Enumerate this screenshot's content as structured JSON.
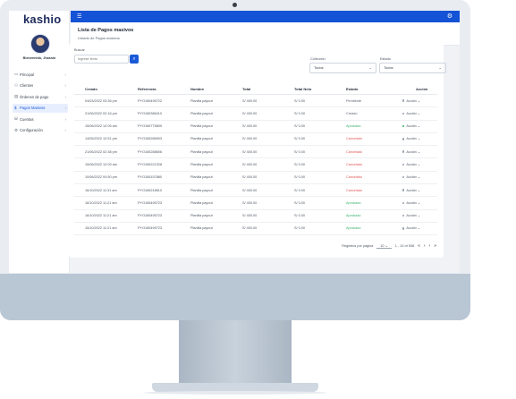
{
  "app": {
    "logo": "kashio",
    "welcome": "Bienvenido, Jhassin"
  },
  "sidebar": {
    "items": [
      {
        "icon": "monitor-icon",
        "glyph": "▭",
        "label": "Principal",
        "active": false
      },
      {
        "icon": "users-icon",
        "glyph": "⚇",
        "label": "Clientes",
        "active": false
      },
      {
        "icon": "clipboard-icon",
        "glyph": "▤",
        "label": "Órdenes de pago",
        "active": false
      },
      {
        "icon": "dollar-icon",
        "glyph": "$",
        "label": "Pagos Masivos",
        "active": true
      },
      {
        "icon": "cart-icon",
        "glyph": "⛁",
        "label": "Cuentas",
        "active": false
      },
      {
        "icon": "gear-icon",
        "glyph": "⚙",
        "label": "Configuración",
        "active": false
      }
    ]
  },
  "header": {
    "title": "Lista de Pagos masivos",
    "subtitle": "Listado de Pagos masivos"
  },
  "filters": {
    "search_label": "Buscar",
    "search_placeholder": "Ingrese texto",
    "coleccion_label": "Colección",
    "coleccion_value": "Todos",
    "estado_label": "Estado",
    "estado_value": "Todos"
  },
  "table": {
    "headers": [
      "Creado",
      "Referencia",
      "Nombre",
      "Total",
      "Total Neto",
      "Estado",
      "Acción"
    ],
    "rows": [
      {
        "creado": "04/03/2022 03:36 pm",
        "ref": "PYO165495722",
        "nombre": "Planilla payout",
        "total": "S/ 400.00",
        "neto": "S/ 0.00",
        "estado": "Pendiente",
        "estado_class": "pendiente",
        "accion": "Acción",
        "dot": "#9aa2ad"
      },
      {
        "creado": "21/06/2022 02:16 pm",
        "ref": "PYO165386410",
        "nombre": "Planilla payout",
        "total": "S/ 400.00",
        "neto": "S/ 0.00",
        "estado": "Creado",
        "estado_class": "creado",
        "accion": "Acción",
        "dot": "#9aa2ad"
      },
      {
        "creado": "15/06/2022 12:05 am",
        "ref": "PYO165775809",
        "nombre": "Planilla payout",
        "total": "S/ 400.00",
        "neto": "S/ 0.00",
        "estado": "Aprobado",
        "estado_class": "aprobado",
        "accion": "Acción",
        "dot": "#38b26a"
      },
      {
        "creado": "14/05/2022 12:51 pm",
        "ref": "PYO165286903",
        "nombre": "Planilla payout",
        "total": "S/ 400.00",
        "neto": "S/ 0.00",
        "estado": "Cancelado",
        "estado_class": "cancelado",
        "accion": "Acción",
        "dot": "#9aa2ad"
      },
      {
        "creado": "21/06/2022 02:38 pm",
        "ref": "PYO165288606",
        "nombre": "Planilla payout",
        "total": "S/ 400.00",
        "neto": "S/ 0.00",
        "estado": "Cancelado",
        "estado_class": "cancelado",
        "accion": "Acción",
        "dot": "#9aa2ad"
      },
      {
        "creado": "15/06/2022 12:09 am",
        "ref": "PYO165221328",
        "nombre": "Planilla payout",
        "total": "S/ 400.00",
        "neto": "S/ 0.00",
        "estado": "Cancelado",
        "estado_class": "cancelado",
        "accion": "Acción",
        "dot": "#9aa2ad"
      },
      {
        "creado": "10/06/2022 04:50 pm",
        "ref": "PYO165157880",
        "nombre": "Planilla payout",
        "total": "S/ 400.00",
        "neto": "S/ 0.00",
        "estado": "Cancelado",
        "estado_class": "cancelado",
        "accion": "Acción",
        "dot": "#9aa2ad"
      },
      {
        "creado": "16/10/2022 11:31 am",
        "ref": "PYO165218510",
        "nombre": "Planilla payout",
        "total": "S/ 400.00",
        "neto": "S/ 0.00",
        "estado": "Cancelado",
        "estado_class": "cancelado",
        "accion": "Acción",
        "dot": "#9aa2ad"
      },
      {
        "creado": "16/10/2022 11:21 am",
        "ref": "PYO165495723",
        "nombre": "Planilla payout",
        "total": "S/ 400.00",
        "neto": "S/ 0.00",
        "estado": "Aprobado",
        "estado_class": "aprobado",
        "accion": "Acción",
        "dot": "#9aa2ad"
      },
      {
        "creado": "16/10/2022 11:21 am",
        "ref": "PYO165495723",
        "nombre": "Planilla payout",
        "total": "S/ 400.00",
        "neto": "S/ 0.00",
        "estado": "Aprobado",
        "estado_class": "aprobado",
        "accion": "Acción",
        "dot": "#9aa2ad"
      },
      {
        "creado": "15/10/2022 11:21 am",
        "ref": "PYO165499723",
        "nombre": "Planilla payout",
        "total": "S/ 400.00",
        "neto": "S/ 0.00",
        "estado": "Aprobado",
        "estado_class": "aprobado",
        "accion": "Acción",
        "dot": "#9aa2ad"
      }
    ]
  },
  "pager": {
    "per_page_label": "Registros por página",
    "per_page": "10",
    "range": "1 - 10 of 508"
  },
  "icons": {
    "menu": "☰",
    "settings": "⚙",
    "search": "⌕",
    "chevron_down": "⌄",
    "chevron_right": "›",
    "first": "«",
    "prev": "‹",
    "next": "›",
    "last": "»"
  }
}
